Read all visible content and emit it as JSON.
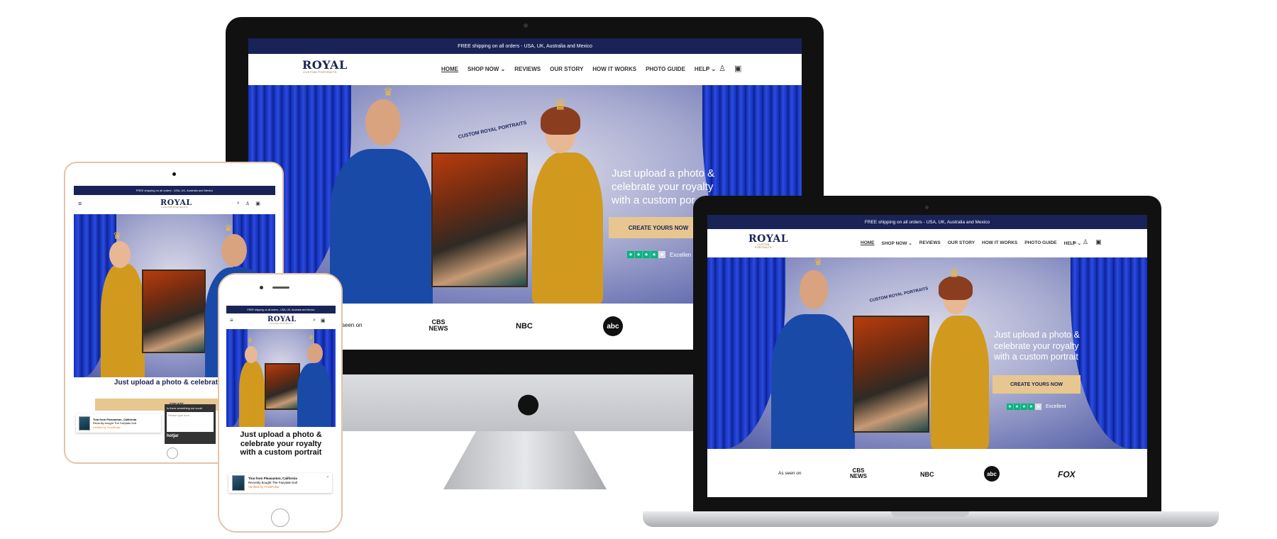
{
  "announcement": "FREE shipping on all orders - USA, UK, Australia and Mexico",
  "logo": {
    "name": "ROYAL",
    "tagline": "CUSTOM PORTRAITS"
  },
  "nav": {
    "items": [
      "HOME",
      "SHOP NOW",
      "REVIEWS",
      "OUR STORY",
      "HOW IT WORKS",
      "PHOTO GUIDE",
      "HELP"
    ],
    "active": "HOME"
  },
  "icons": [
    "search-icon",
    "account-icon",
    "cart-icon",
    "menu-icon",
    "chevron-down-icon",
    "apple-logo"
  ],
  "hero": {
    "headline_desktop": "Just upload a photo & celebrate your royalty with a custom portrait",
    "headline_imac": "Just upload a photo & celebrate your royalty with a custom por",
    "headline_mobile": "Just upload a photo & celebrate your royalty with a custom portrait",
    "headline_tablet": "Just upload a photo & celebrate your",
    "cta": "CREATE YOURS NOW",
    "cta_tablet": "CREATE",
    "cta_imac": "CREATE YOURS NOW",
    "trustpilot_label": "Excellent",
    "trustpilot_label_imac": "Excellen",
    "badge_text": "CUSTOM ROYAL PORTRAITS"
  },
  "as_seen_on": {
    "label": "As seen on",
    "label_imac": "seen on",
    "logos": [
      "CBS NEWS",
      "NBC",
      "abc",
      "FOX"
    ]
  },
  "review_popup": {
    "name": "Tina from Pleasanton, California",
    "name_tablet": "Tina from Pleasanton, California",
    "action": "Recently bought The Fairytale Doll",
    "action_tablet": "Recently bought The Fairytale Doll",
    "verified": "Verified by TrustPulse"
  },
  "hotjar": {
    "question": "Is there something we could",
    "placeholder": "Please type here...",
    "brand": "hotjar"
  },
  "colors": {
    "navy": "#1a2357",
    "cta": "#e7c690",
    "trustpilot": "#00b67a",
    "curtain": "#1434c4"
  }
}
